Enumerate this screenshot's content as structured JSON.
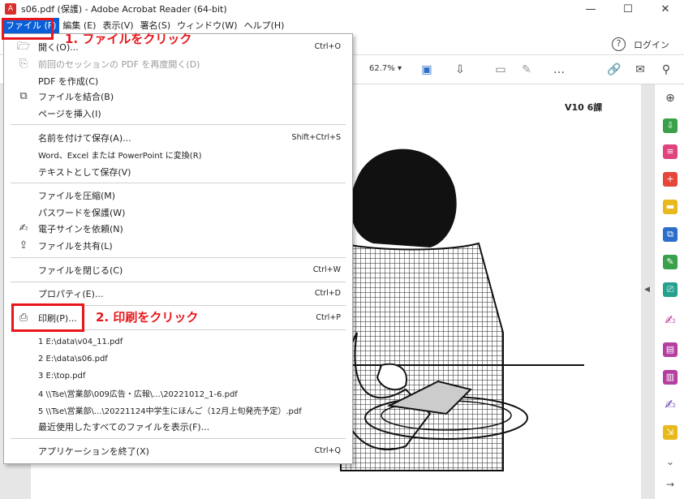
{
  "titlebar": {
    "title": "s06.pdf (保護) - Adobe Acrobat Reader (64-bit)",
    "app_icon": "pdf-icon",
    "minimize": "—",
    "maximize": "☐",
    "close": "✕"
  },
  "menubar": {
    "items": [
      "ファイル (F)",
      "編集 (E)",
      "表示(V)",
      "署名(S)",
      "ウィンドウ(W)",
      "ヘルプ(H)"
    ]
  },
  "apptoolbar": {
    "help": "?",
    "login": "ログイン"
  },
  "doctoolbar": {
    "zoom": "62.7%"
  },
  "document": {
    "page_label": "V10 6課"
  },
  "file_menu": {
    "items": [
      {
        "label": "開く(O)...",
        "shortcut": "Ctrl+O",
        "icon": "folder-open-icon",
        "disabled": false
      },
      {
        "label": "前回のセッションの PDF を再度開く(D)",
        "shortcut": "",
        "icon": "restore-session-icon",
        "disabled": true
      },
      {
        "label": "PDF を作成(C)",
        "shortcut": "",
        "icon": "",
        "disabled": false
      },
      {
        "label": "ファイルを結合(B)",
        "shortcut": "",
        "icon": "combine-files-icon",
        "disabled": false
      },
      {
        "label": "ページを挿入(I)",
        "shortcut": "",
        "icon": "",
        "disabled": false
      },
      {
        "label": "名前を付けて保存(A)...",
        "shortcut": "Shift+Ctrl+S",
        "icon": "",
        "disabled": false
      },
      {
        "label": "Word、Excel または PowerPoint に変換(R)",
        "shortcut": "",
        "icon": "",
        "disabled": false
      },
      {
        "label": "テキストとして保存(V)",
        "shortcut": "",
        "icon": "",
        "disabled": false
      },
      {
        "label": "ファイルを圧縮(M)",
        "shortcut": "",
        "icon": "",
        "disabled": false
      },
      {
        "label": "パスワードを保護(W)",
        "shortcut": "",
        "icon": "",
        "disabled": false
      },
      {
        "label": "電子サインを依頼(N)",
        "shortcut": "",
        "icon": "signature-request-icon",
        "disabled": false
      },
      {
        "label": "ファイルを共有(L)",
        "shortcut": "",
        "icon": "share-icon",
        "disabled": false
      },
      {
        "label": "ファイルを閉じる(C)",
        "shortcut": "Ctrl+W",
        "icon": "",
        "disabled": false
      },
      {
        "label": "プロパティ(E)...",
        "shortcut": "Ctrl+D",
        "icon": "",
        "disabled": false
      },
      {
        "label": "印刷(P)...",
        "shortcut": "Ctrl+P",
        "icon": "printer-icon",
        "disabled": false
      },
      {
        "label": "1 E:\\data\\v04_11.pdf",
        "shortcut": "",
        "icon": "",
        "disabled": false
      },
      {
        "label": "2 E:\\data\\s06.pdf",
        "shortcut": "",
        "icon": "",
        "disabled": false
      },
      {
        "label": "3 E:\\top.pdf",
        "shortcut": "",
        "icon": "",
        "disabled": false
      },
      {
        "label": "4 \\\\Tse\\営業部\\009広告・広報\\...\\20221012_1-6.pdf",
        "shortcut": "",
        "icon": "",
        "disabled": false
      },
      {
        "label": "5 \\\\Tse\\営業部\\...\\20221124中学生にほんご（12月上旬発売予定）.pdf",
        "shortcut": "",
        "icon": "",
        "disabled": false
      },
      {
        "label": "最近使用したすべてのファイルを表示(F)...",
        "shortcut": "",
        "icon": "",
        "disabled": false
      },
      {
        "label": "アプリケーションを終了(X)",
        "shortcut": "Ctrl+Q",
        "icon": "",
        "disabled": false
      }
    ]
  },
  "annotations": {
    "step1": "1. ファイルをクリック",
    "step2": "2. 印刷をクリック",
    "color": "#e8161b"
  },
  "colors": {
    "menu_highlight": "#0a5fd8",
    "annotation": "#e8161b"
  }
}
